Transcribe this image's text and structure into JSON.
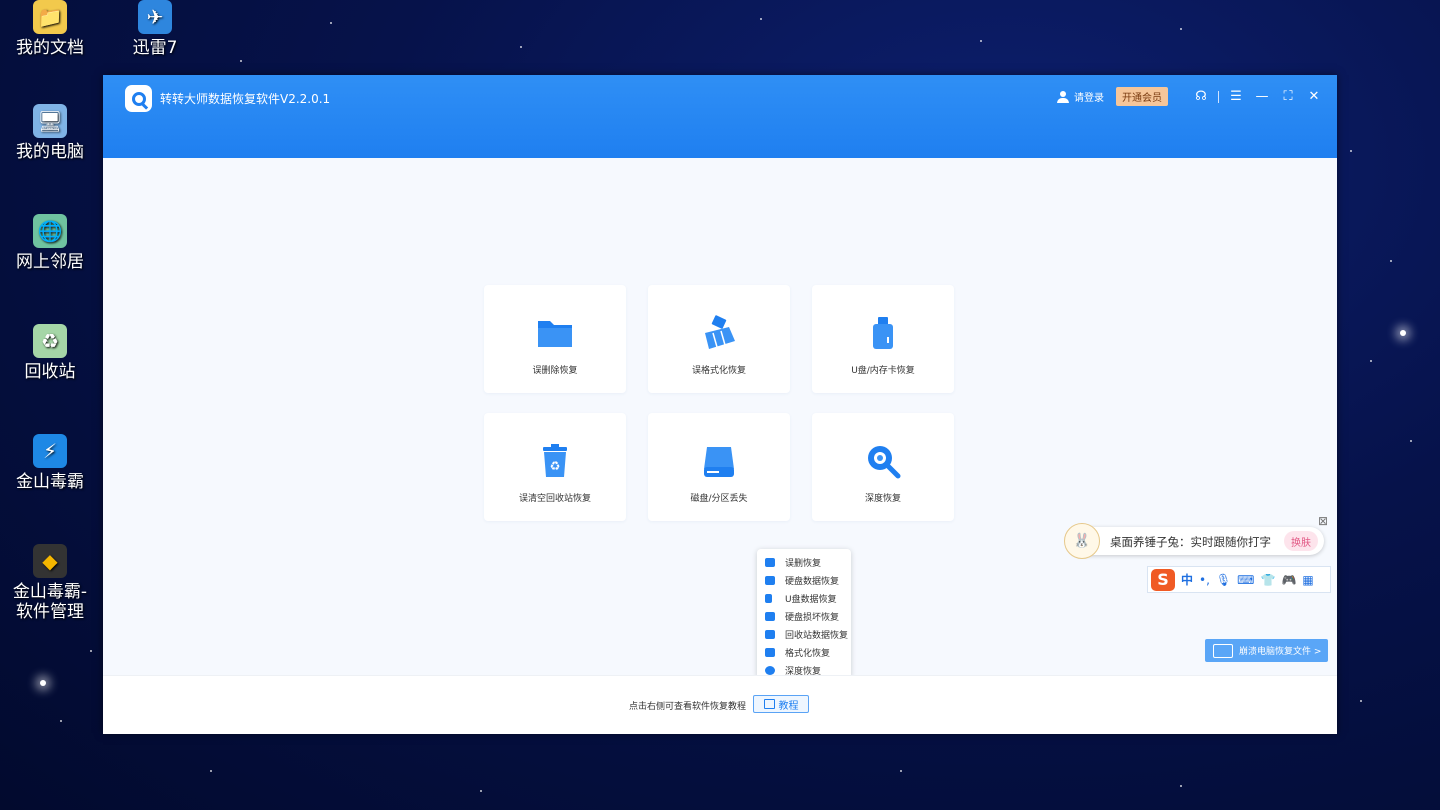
{
  "desktop": {
    "icons": [
      {
        "label": "我的文档"
      },
      {
        "label": "迅雷7"
      },
      {
        "label": "我的电脑"
      },
      {
        "label": "网上邻居"
      },
      {
        "label": "回收站"
      },
      {
        "label": "金山毒霸"
      },
      {
        "label": "金山毒霸-\n软件管理"
      }
    ]
  },
  "window": {
    "title": "转转大师数据恢复软件V2.2.0.1",
    "login_label": "请登录",
    "vip_label": "开通会员"
  },
  "cards": [
    {
      "label": "误删除恢复",
      "icon": "folder-icon"
    },
    {
      "label": "误格式化恢复",
      "icon": "broom-icon"
    },
    {
      "label": "U盘/内存卡恢复",
      "icon": "usb-drive-icon"
    },
    {
      "label": "误清空回收站恢复",
      "icon": "recycle-bin-icon"
    },
    {
      "label": "磁盘/分区丢失",
      "icon": "disk-icon"
    },
    {
      "label": "深度恢复",
      "icon": "magnifier-icon"
    }
  ],
  "popup_menu": [
    {
      "label": "误删恢复"
    },
    {
      "label": "硬盘数据恢复"
    },
    {
      "label": "U盘数据恢复"
    },
    {
      "label": "硬盘损坏恢复"
    },
    {
      "label": "回收站数据恢复"
    },
    {
      "label": "格式化恢复"
    },
    {
      "label": "深度恢复"
    }
  ],
  "bottom": {
    "hint": "点击右侧可查看软件恢复教程",
    "tutorial_label": "教程"
  },
  "ime": {
    "banner_text": "桌面养锤子兔：实时跟随你打字",
    "skin_label": "换肤",
    "logo": "S",
    "lang": "中",
    "punct": "•,"
  },
  "recover_banner": "崩溃电脑恢复文件 >",
  "colors": {
    "brand": "#1f7ff0",
    "vip": "#f6c69a",
    "ime_logo": "#f05a24"
  }
}
